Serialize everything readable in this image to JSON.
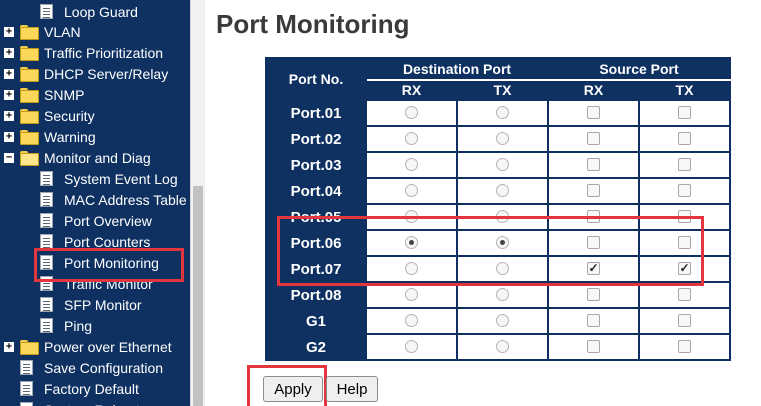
{
  "sidebar": {
    "items": [
      {
        "label": "Loop Guard",
        "type": "page",
        "level": 2
      },
      {
        "label": "VLAN",
        "type": "folder",
        "level": 1,
        "expander": "+"
      },
      {
        "label": "Traffic Prioritization",
        "type": "folder",
        "level": 1,
        "expander": "+"
      },
      {
        "label": "DHCP Server/Relay",
        "type": "folder",
        "level": 1,
        "expander": "+"
      },
      {
        "label": "SNMP",
        "type": "folder",
        "level": 1,
        "expander": "+"
      },
      {
        "label": "Security",
        "type": "folder",
        "level": 1,
        "expander": "+"
      },
      {
        "label": "Warning",
        "type": "folder",
        "level": 1,
        "expander": "+"
      },
      {
        "label": "Monitor and Diag",
        "type": "folder",
        "level": 1,
        "expander": "−",
        "open": true
      },
      {
        "label": "System Event Log",
        "type": "page",
        "level": 2
      },
      {
        "label": "MAC Address Table",
        "type": "page",
        "level": 2
      },
      {
        "label": "Port Overview",
        "type": "page",
        "level": 2
      },
      {
        "label": "Port Counters",
        "type": "page",
        "level": 2
      },
      {
        "label": "Port Monitoring",
        "type": "page",
        "level": 2,
        "selected": true
      },
      {
        "label": "Traffic Monitor",
        "type": "page",
        "level": 2
      },
      {
        "label": "SFP Monitor",
        "type": "page",
        "level": 2
      },
      {
        "label": "Ping",
        "type": "page",
        "level": 2
      },
      {
        "label": "Power over Ethernet",
        "type": "folder",
        "level": 1,
        "expander": "+"
      },
      {
        "label": "Save Configuration",
        "type": "page",
        "level": 0
      },
      {
        "label": "Factory Default",
        "type": "page",
        "level": 0
      },
      {
        "label": "System Reboot",
        "type": "page",
        "level": 0
      }
    ]
  },
  "main": {
    "title": "Port Monitoring",
    "table": {
      "port_header": "Port No.",
      "dest_header": "Destination Port",
      "source_header": "Source Port",
      "sub_rx": "RX",
      "sub_tx": "TX",
      "rows": [
        {
          "port": "Port.01",
          "dest_rx": false,
          "dest_tx": false,
          "src_rx": false,
          "src_tx": false
        },
        {
          "port": "Port.02",
          "dest_rx": false,
          "dest_tx": false,
          "src_rx": false,
          "src_tx": false
        },
        {
          "port": "Port.03",
          "dest_rx": false,
          "dest_tx": false,
          "src_rx": false,
          "src_tx": false
        },
        {
          "port": "Port.04",
          "dest_rx": false,
          "dest_tx": false,
          "src_rx": false,
          "src_tx": false
        },
        {
          "port": "Port.05",
          "dest_rx": false,
          "dest_tx": false,
          "src_rx": false,
          "src_tx": false
        },
        {
          "port": "Port.06",
          "dest_rx": true,
          "dest_tx": true,
          "src_rx": false,
          "src_tx": false
        },
        {
          "port": "Port.07",
          "dest_rx": false,
          "dest_tx": false,
          "src_rx": true,
          "src_tx": true
        },
        {
          "port": "Port.08",
          "dest_rx": false,
          "dest_tx": false,
          "src_rx": false,
          "src_tx": false
        },
        {
          "port": "G1",
          "dest_rx": false,
          "dest_tx": false,
          "src_rx": false,
          "src_tx": false
        },
        {
          "port": "G2",
          "dest_rx": false,
          "dest_tx": false,
          "src_rx": false,
          "src_tx": false
        }
      ]
    },
    "apply_label": "Apply",
    "help_label": "Help"
  },
  "colors": {
    "sidebar_bg": "#0e3162",
    "header_bg": "#0e3162",
    "highlight": "#e2353e"
  }
}
